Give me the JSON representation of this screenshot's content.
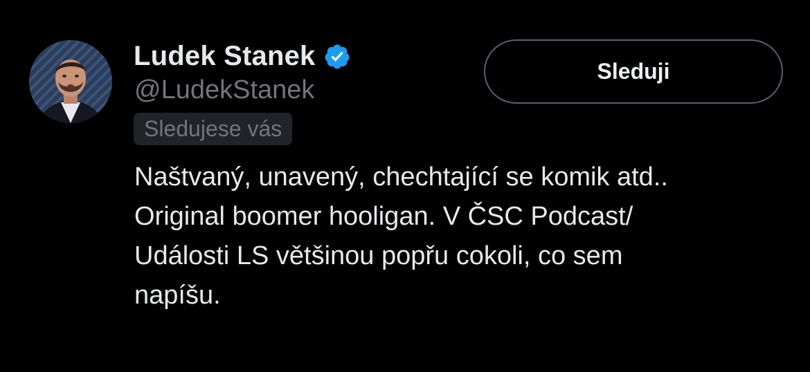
{
  "profile": {
    "display_name": "Ludek Stanek",
    "handle": "@LudekStanek",
    "follows_you_label": "Sledujese vás",
    "verified": true,
    "verified_icon": "verified-badge-icon",
    "avatar_icon": "profile-photo"
  },
  "actions": {
    "follow_label": "Sleduji"
  },
  "bio": {
    "lines": [
      "Naštvaný, unavený, chechtající se komik atd..",
      "Original boomer hooligan. V ČSC Podcast/",
      "Události LS většinou popřu cokoli, co sem",
      "napíšu."
    ]
  },
  "colors": {
    "background": "#000000",
    "primary_text": "#e7e9ea",
    "secondary_text": "#71767b",
    "verified_blue": "#1d9bf0",
    "button_border": "#536471",
    "badge_background": "#202327"
  }
}
